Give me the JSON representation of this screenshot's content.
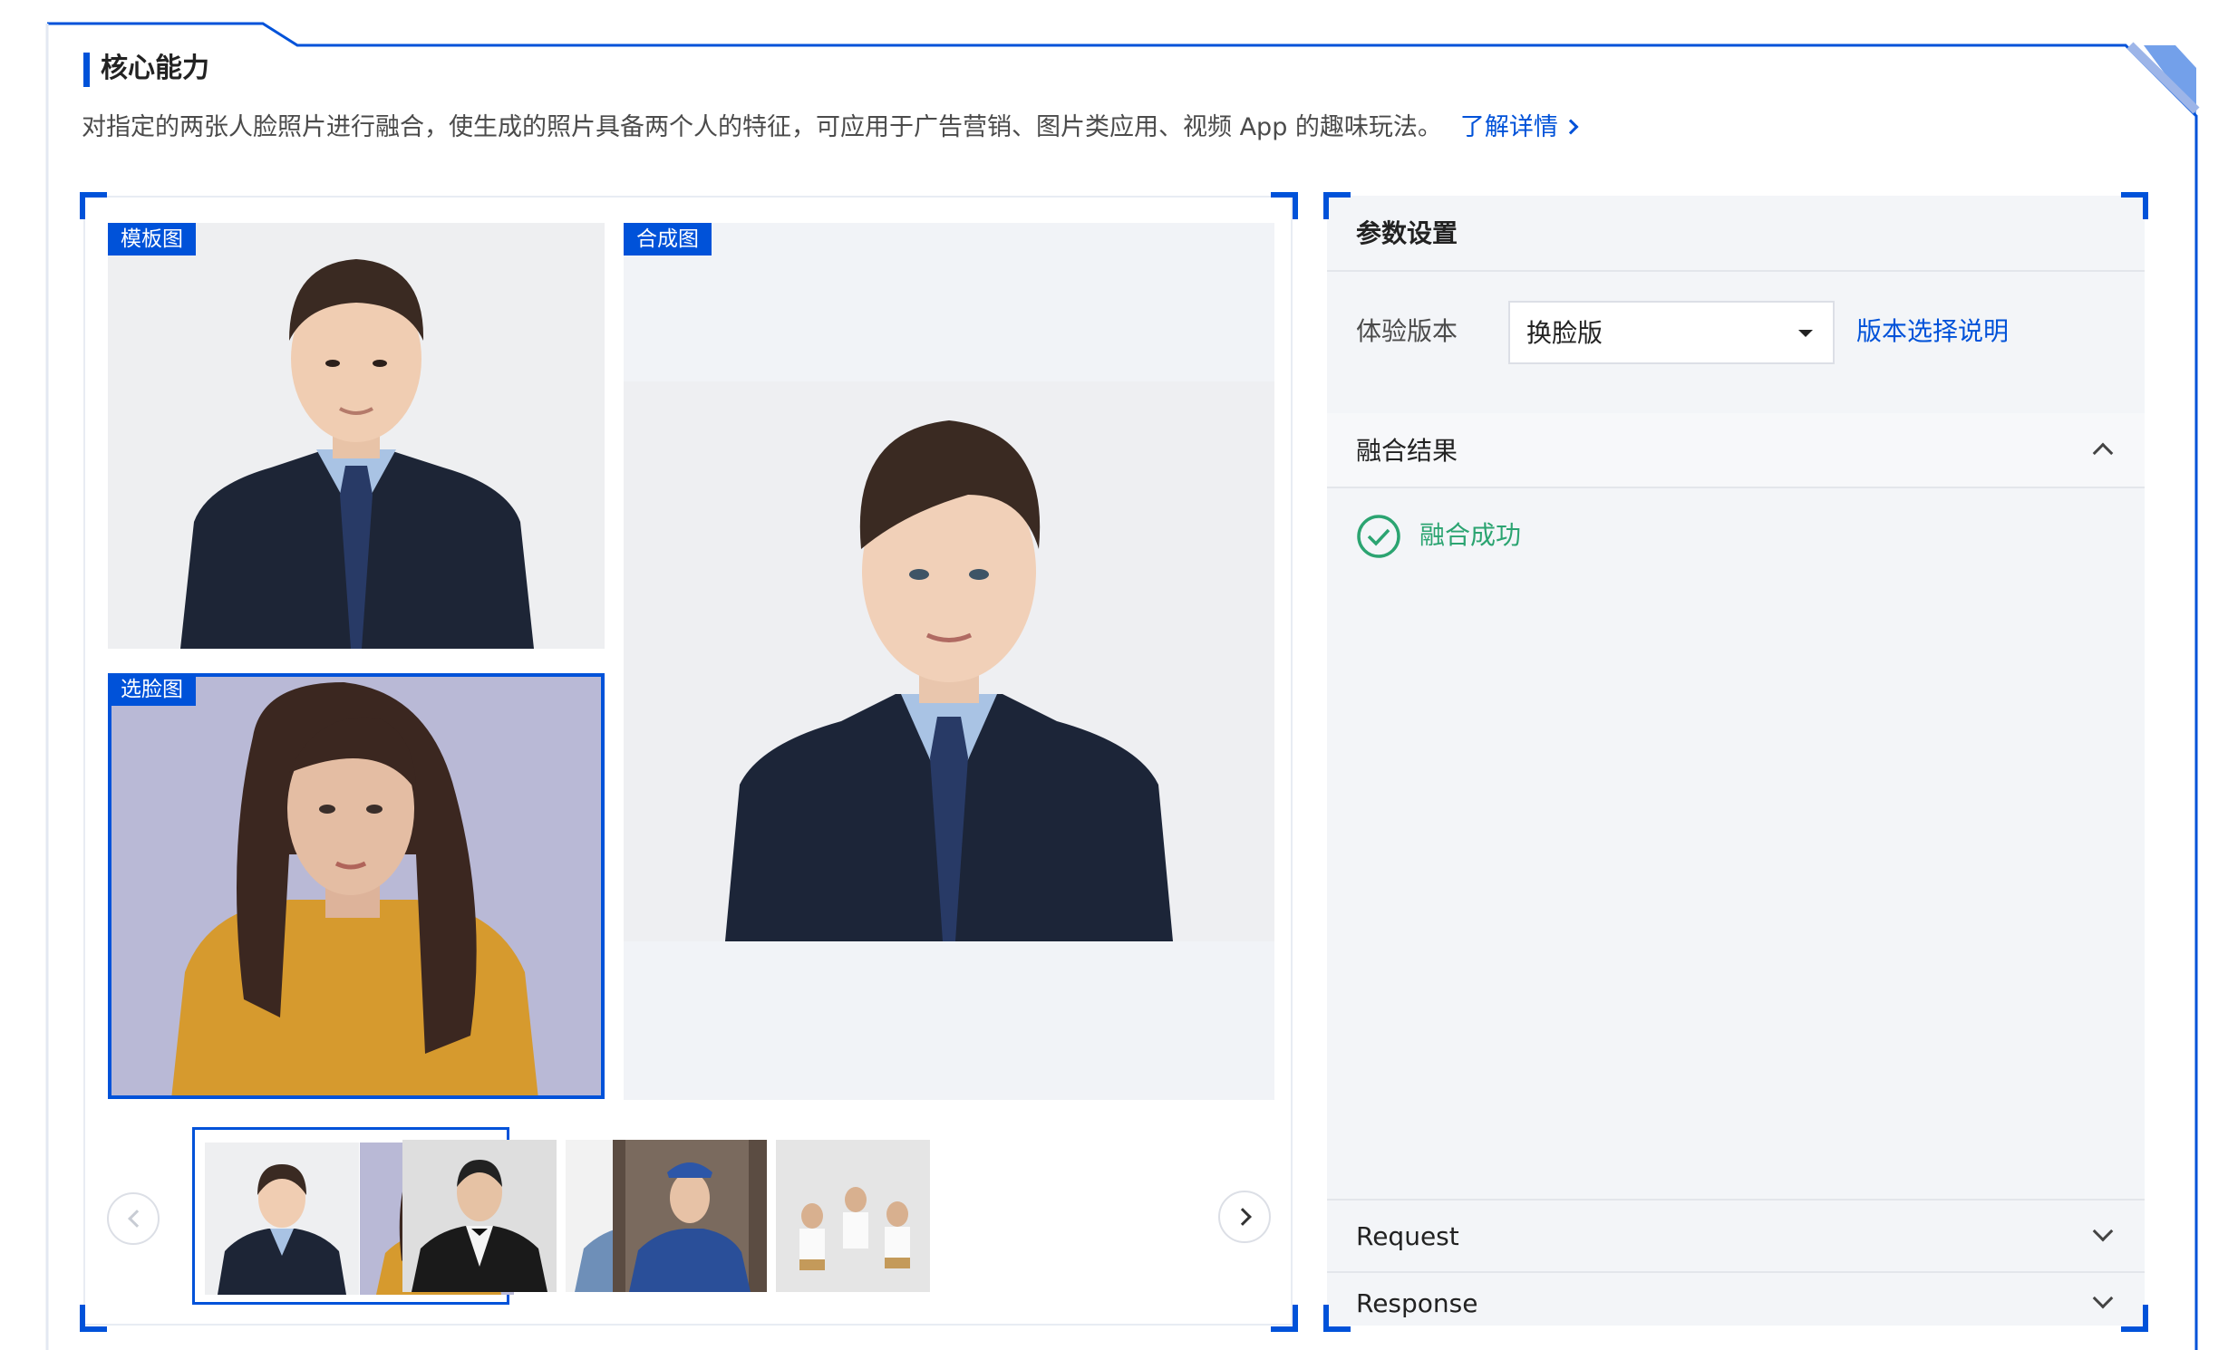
{
  "section": {
    "title": "核心能力",
    "description": "对指定的两张人脸照片进行融合，使生成的照片具备两个人的特征，可应用于广告营销、图片类应用、视频 App 的趣味玩法。",
    "learn_more": "了解详情"
  },
  "images": {
    "template_tag": "模板图",
    "result_tag": "合成图",
    "face_tag": "选脸图"
  },
  "carousel": {
    "prev_icon": "chevron-left-icon",
    "next_icon": "chevron-right-icon",
    "active_index": 0
  },
  "params": {
    "title": "参数设置",
    "version_label": "体验版本",
    "version_value": "换脸版",
    "version_help": "版本选择说明"
  },
  "result": {
    "title": "融合结果",
    "status": "融合成功",
    "status_color": "#2ba471"
  },
  "request": {
    "title": "Request"
  },
  "response": {
    "title": "Response"
  },
  "colors": {
    "accent": "#0052d9",
    "panel_bg": "#f3f5f8"
  }
}
